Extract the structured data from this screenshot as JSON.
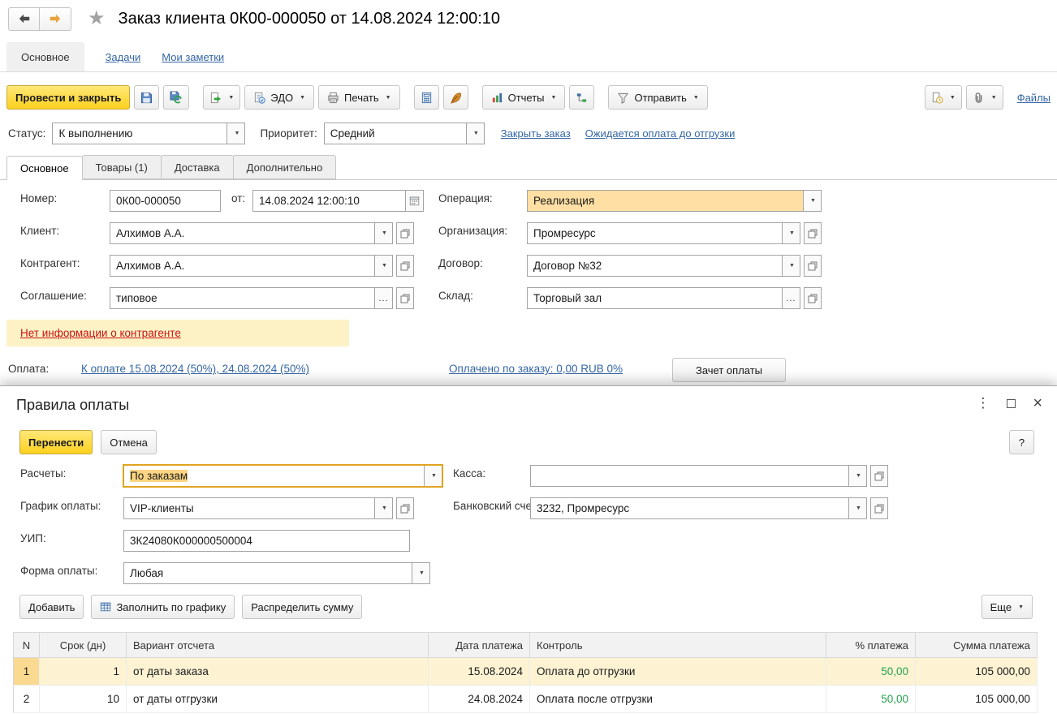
{
  "icons": {
    "caret": "▼",
    "kebab": "⋮",
    "close": "×",
    "dots": "..."
  },
  "header": {
    "title": "Заказ клиента 0К00-000050 от 14.08.2024 12:00:10"
  },
  "nav_tabs": {
    "main": "Основное",
    "tasks": "Задачи",
    "notes": "Мои заметки"
  },
  "toolbar": {
    "post_close": "Провести и закрыть",
    "edo": "ЭДО",
    "print": "Печать",
    "reports": "Отчеты",
    "send": "Отправить",
    "files": "Файлы"
  },
  "status_row": {
    "status_label": "Статус:",
    "status_value": "К выполнению",
    "priority_label": "Приоритет:",
    "priority_value": "Средний",
    "close_order_link": "Закрыть заказ",
    "awaiting_link": "Ожидается оплата до отгрузки"
  },
  "form_tabs": {
    "main": "Основное",
    "goods": "Товары (1)",
    "delivery": "Доставка",
    "extra": "Дополнительно"
  },
  "fields": {
    "number_label": "Номер:",
    "number_value": "0К00-000050",
    "date_label": "от:",
    "date_value": "14.08.2024 12:00:10",
    "operation_label": "Операция:",
    "operation_value": "Реализация",
    "client_label": "Клиент:",
    "client_value": "Алхимов А.А.",
    "org_label": "Организация:",
    "org_value": "Промресурс",
    "counterparty_label": "Контрагент:",
    "counterparty_value": "Алхимов А.А.",
    "contract_label": "Договор:",
    "contract_value": "Договор №32",
    "agreement_label": "Соглашение:",
    "agreement_value": "типовое",
    "warehouse_label": "Склад:",
    "warehouse_value": "Торговый зал"
  },
  "warning_link": "Нет информации о контрагенте",
  "payment": {
    "label": "Оплата:",
    "due_link": "К оплате 15.08.2024 (50%), 24.08.2024 (50%)",
    "paid_link": "Оплачено по заказу: 0,00 RUB 0%",
    "offset_button": "Зачет оплаты"
  },
  "dialog": {
    "title": "Правила оплаты",
    "transfer_button": "Перенести",
    "cancel_button": "Отмена",
    "help_button": "?",
    "fields": {
      "settlements_label": "Расчеты:",
      "settlements_value": "По заказам",
      "cashbox_label": "Касса:",
      "cashbox_value": "",
      "schedule_label": "График оплаты:",
      "schedule_value": "VIP-клиенты",
      "bank_label": "Банковский счет:",
      "bank_value": "3232, Промресурс",
      "uip_label": "УИП:",
      "uip_value": "3К24080К000000500004",
      "payform_label": "Форма оплаты:",
      "payform_value": "Любая"
    },
    "commands": {
      "add": "Добавить",
      "fill": "Заполнить по графику",
      "distribute": "Распределить сумму",
      "more": "Еще"
    },
    "table": {
      "columns": [
        "N",
        "Срок (дн)",
        "Вариант отсчета",
        "Дата платежа",
        "Контроль",
        "% платежа",
        "Сумма платежа"
      ],
      "rows": [
        {
          "n": "1",
          "term_days": "1",
          "variant": "от даты заказа",
          "date": "15.08.2024",
          "control": "Оплата до отгрузки",
          "percent": "50,00",
          "amount": "105 000,00"
        },
        {
          "n": "2",
          "term_days": "10",
          "variant": "от даты отгрузки",
          "date": "24.08.2024",
          "control": "Оплата после отгрузки",
          "percent": "50,00",
          "amount": "105 000,00"
        }
      ]
    }
  },
  "colors": {
    "primary_button": "#FCD11F",
    "link": "#3566A5",
    "warning_bg": "#FCF2C6",
    "warning_link": "#CC1111",
    "operation_bg": "#FFDFA3",
    "row_highlight": "#FDF3D3",
    "row_marker": "#F9DA90",
    "percent_green": "#21A14D"
  }
}
